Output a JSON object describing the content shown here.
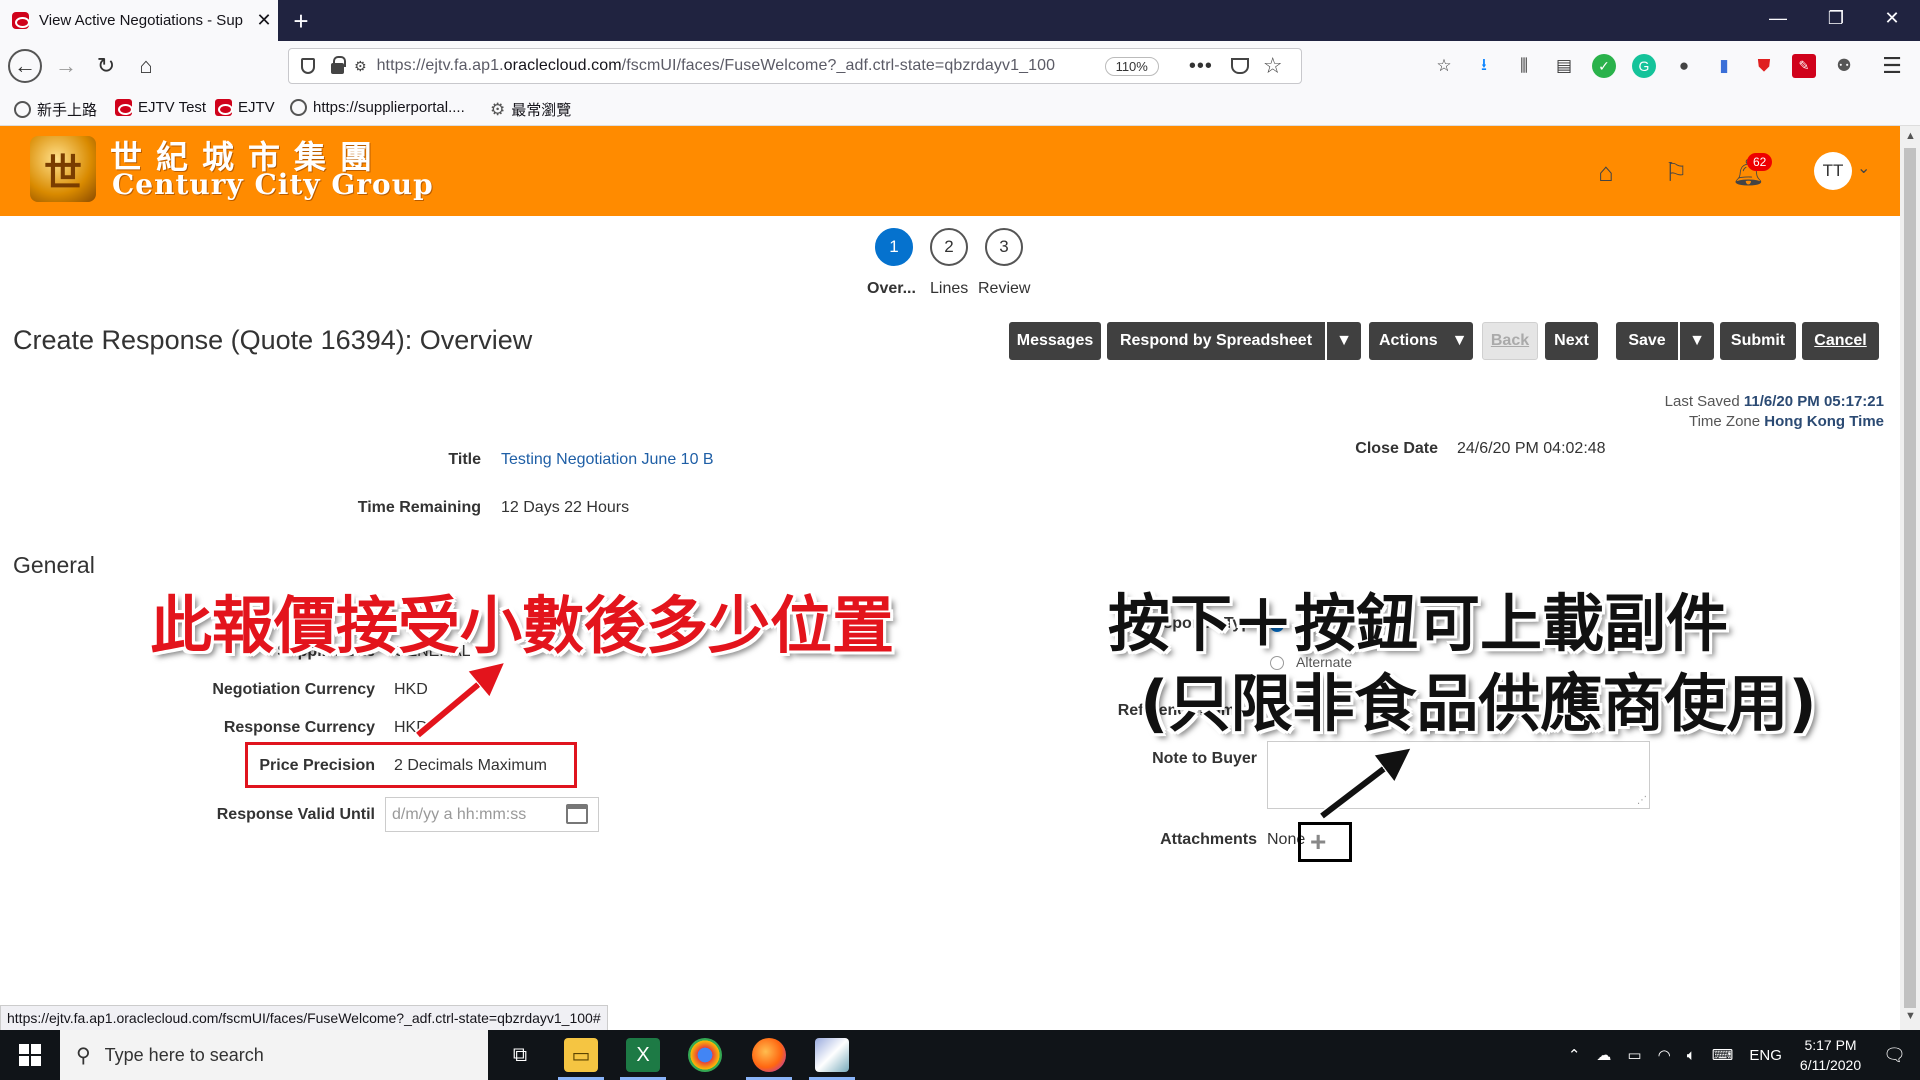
{
  "browser": {
    "tab_title": "View Active Negotiations - Sup",
    "url_prefix": "https://ejtv.fa.ap1.",
    "url_domain": "oraclecloud.com",
    "url_suffix": "/fscmUI/faces/FuseWelcome?_adf.ctrl-state=qbzrdayv1_100",
    "zoom": "110%",
    "bookmarks": [
      "新手上路",
      "EJTV Test",
      "EJTV",
      "https://supplierportal....",
      "最常瀏覽"
    ],
    "status_url": "https://ejtv.fa.ap1.oraclecloud.com/fscmUI/faces/FuseWelcome?_adf.ctrl-state=qbzrdayv1_100#"
  },
  "header": {
    "logo_cn": "世紀城市集團",
    "logo_en": "Century City Group",
    "notification_count": "62",
    "avatar_initials": "TT"
  },
  "train": {
    "steps": [
      {
        "num": "1",
        "label": "Over..."
      },
      {
        "num": "2",
        "label": "Lines"
      },
      {
        "num": "3",
        "label": "Review"
      }
    ]
  },
  "page": {
    "title": "Create Response (Quote 16394): Overview",
    "buttons": {
      "messages": "Messages",
      "respond_by_spreadsheet": "Respond by Spreadsheet",
      "actions": "Actions",
      "back": "Back",
      "next": "Next",
      "save": "Save",
      "submit": "Submit",
      "cancel": "Cancel"
    },
    "last_saved_label": "Last Saved",
    "last_saved_value": "11/6/20 PM 05:17:21",
    "time_zone_label": "Time Zone",
    "time_zone_value": "Hong Kong Time"
  },
  "summary": {
    "title_label": "Title",
    "title_value": "Testing Negotiation June 10 B",
    "time_remaining_label": "Time Remaining",
    "time_remaining_value": "12 Days 22 Hours",
    "close_date_label": "Close Date",
    "close_date_value": "24/6/20 PM 04:02:48"
  },
  "general": {
    "heading": "General",
    "supplier_site_label": "Supplier Site",
    "supplier_site_value": "GENERAL",
    "negotiation_currency_label": "Negotiation Currency",
    "negotiation_currency_value": "HKD",
    "response_currency_label": "Response Currency",
    "response_currency_value": "HKD",
    "price_precision_label": "Price Precision",
    "price_precision_value": "2 Decimals Maximum",
    "response_valid_until_label": "Response Valid Until",
    "response_valid_until_placeholder": "d/m/yy a hh:mm:ss",
    "response_type_label": "Response Type",
    "response_type_option2": "Alternate",
    "reference_number_label": "Reference Number",
    "note_to_buyer_label": "Note to Buyer",
    "attachments_label": "Attachments",
    "attachments_value": "None"
  },
  "annotations": {
    "red_text": "此報價接受小數後多少位置",
    "black_line1": "按下＋按鈕可上載副件",
    "black_line2": "(只限非食品供應商使用)"
  },
  "taskbar": {
    "search_placeholder": "Type here to search",
    "language": "ENG",
    "time": "5:17 PM",
    "date": "6/11/2020"
  },
  "colors": {
    "header_orange": "#ff8b00",
    "train_active": "#0572ce",
    "button_dark": "#404040",
    "annotation_red": "#e3141c"
  }
}
